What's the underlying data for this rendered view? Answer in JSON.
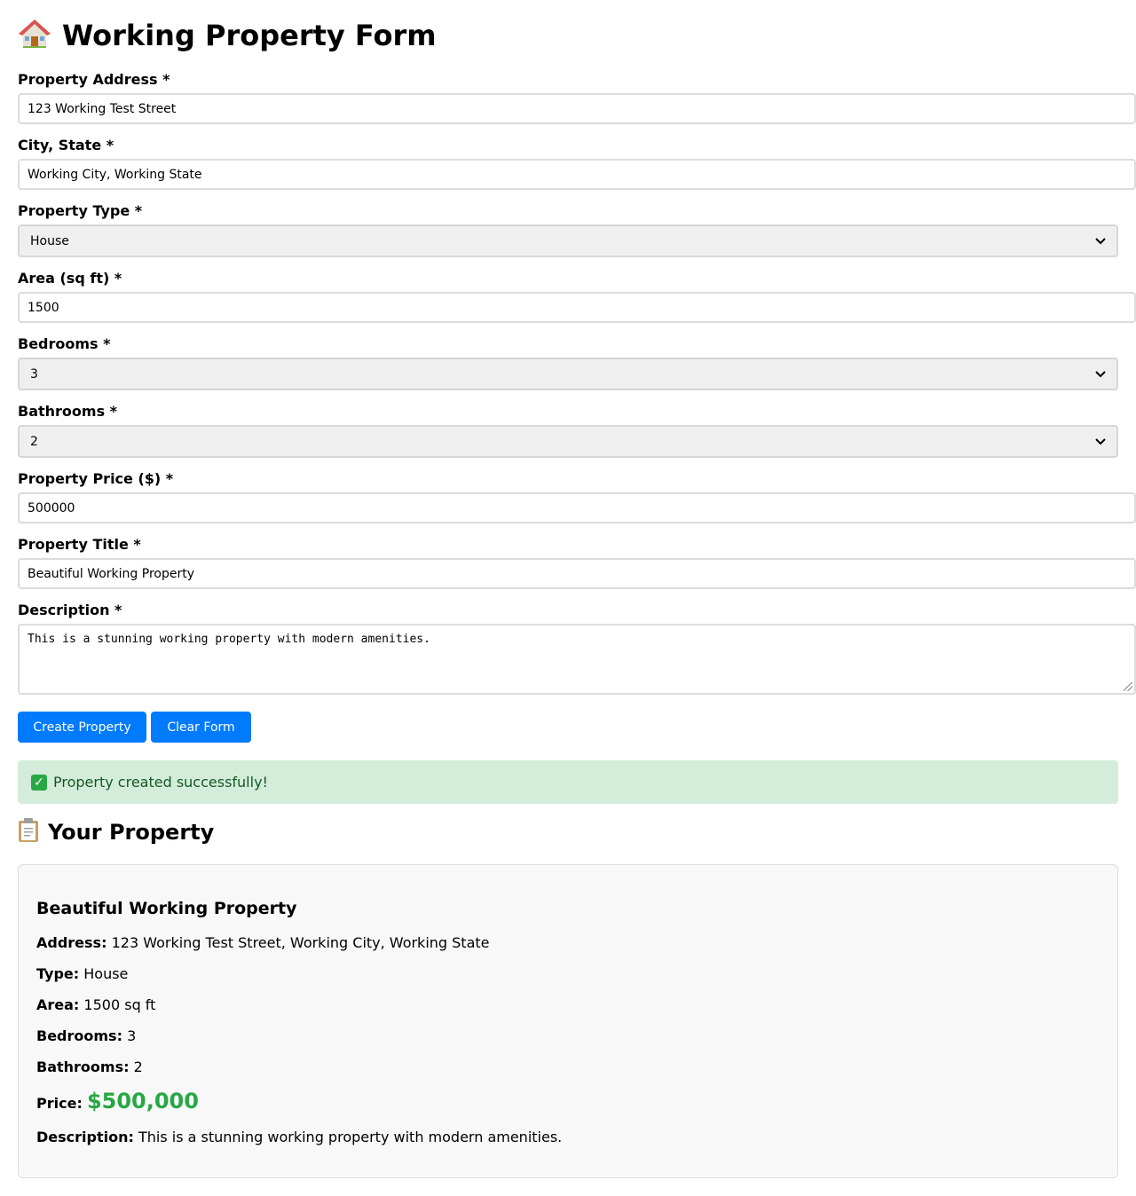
{
  "page": {
    "title": "Working Property Form",
    "title_icon": "house-icon"
  },
  "form": {
    "address": {
      "label": "Property Address *",
      "value": "123 Working Test Street"
    },
    "city_state": {
      "label": "City, State *",
      "value": "Working City, Working State"
    },
    "property_type": {
      "label": "Property Type *",
      "value": "House"
    },
    "area": {
      "label": "Area (sq ft) *",
      "value": "1500"
    },
    "bedrooms": {
      "label": "Bedrooms *",
      "value": "3"
    },
    "bathrooms": {
      "label": "Bathrooms *",
      "value": "2"
    },
    "price": {
      "label": "Property Price ($) *",
      "value": "500000"
    },
    "property_title": {
      "label": "Property Title *",
      "value": "Beautiful Working Property"
    },
    "description": {
      "label": "Description *",
      "value": "This is a stunning working property with modern amenities."
    }
  },
  "buttons": {
    "create": "Create Property",
    "clear": "Clear Form"
  },
  "alert": {
    "icon": "check-mark-icon",
    "text": "Property created successfully!"
  },
  "result": {
    "heading": "Your Property",
    "heading_icon": "clipboard-icon",
    "title": "Beautiful Working Property",
    "address_label": "Address:",
    "address": "123 Working Test Street, Working City, Working State",
    "type_label": "Type:",
    "type": "House",
    "area_label": "Area:",
    "area": "1500 sq ft",
    "bedrooms_label": "Bedrooms:",
    "bedrooms": "3",
    "bathrooms_label": "Bathrooms:",
    "bathrooms": "2",
    "price_label": "Price:",
    "price": "$500,000",
    "description_label": "Description:",
    "description": "This is a stunning working property with modern amenities."
  },
  "colors": {
    "primary_button": "#007bff",
    "success_bg": "#d4edda",
    "success_text": "#155724",
    "price": "#28a745"
  }
}
